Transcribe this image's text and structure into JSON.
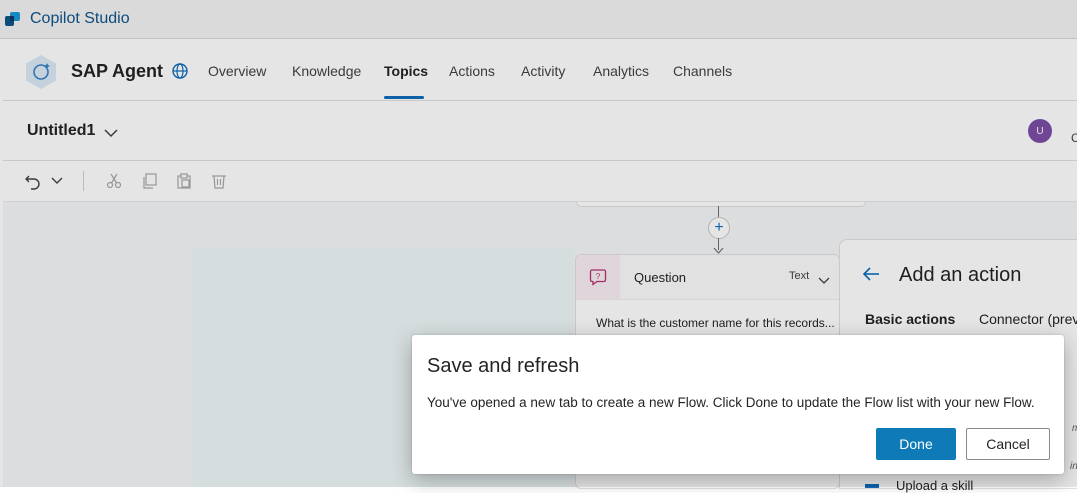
{
  "app": {
    "title": "Copilot Studio",
    "logo_icon": "copilot-studio-logo"
  },
  "agent": {
    "name": "SAP Agent",
    "tabs": [
      {
        "label": "Overview",
        "active": false
      },
      {
        "label": "Knowledge",
        "active": false
      },
      {
        "label": "Topics",
        "active": true
      },
      {
        "label": "Actions",
        "active": false
      },
      {
        "label": "Activity",
        "active": false
      },
      {
        "label": "Analytics",
        "active": false
      },
      {
        "label": "Channels",
        "active": false
      }
    ]
  },
  "topic": {
    "name": "Untitled1",
    "user_initial": "U",
    "truncated_label": "C"
  },
  "toolbar": {
    "icons": [
      "undo-icon",
      "chevron-down-icon",
      "cut-icon",
      "copy-icon",
      "paste-icon",
      "delete-icon"
    ]
  },
  "canvas": {
    "question_node": {
      "title": "Question",
      "type": "Text",
      "prompt": "What is the customer name for this records..."
    }
  },
  "action_panel": {
    "title": "Add an action",
    "tabs": [
      "Basic actions",
      "Connector (preview)"
    ],
    "partial_text_1": "mp",
    "partial_text_2": "ing",
    "partial_item": "Upload a skill"
  },
  "dialog": {
    "title": "Save and refresh",
    "message": "You've opened a new tab to create a new Flow. Click Done to update the Flow list with your new Flow.",
    "done_label": "Done",
    "cancel_label": "Cancel"
  },
  "colors": {
    "accent": "#0f6cbd",
    "done_button": "#0f7ab8",
    "avatar": "#7b4ea6"
  }
}
